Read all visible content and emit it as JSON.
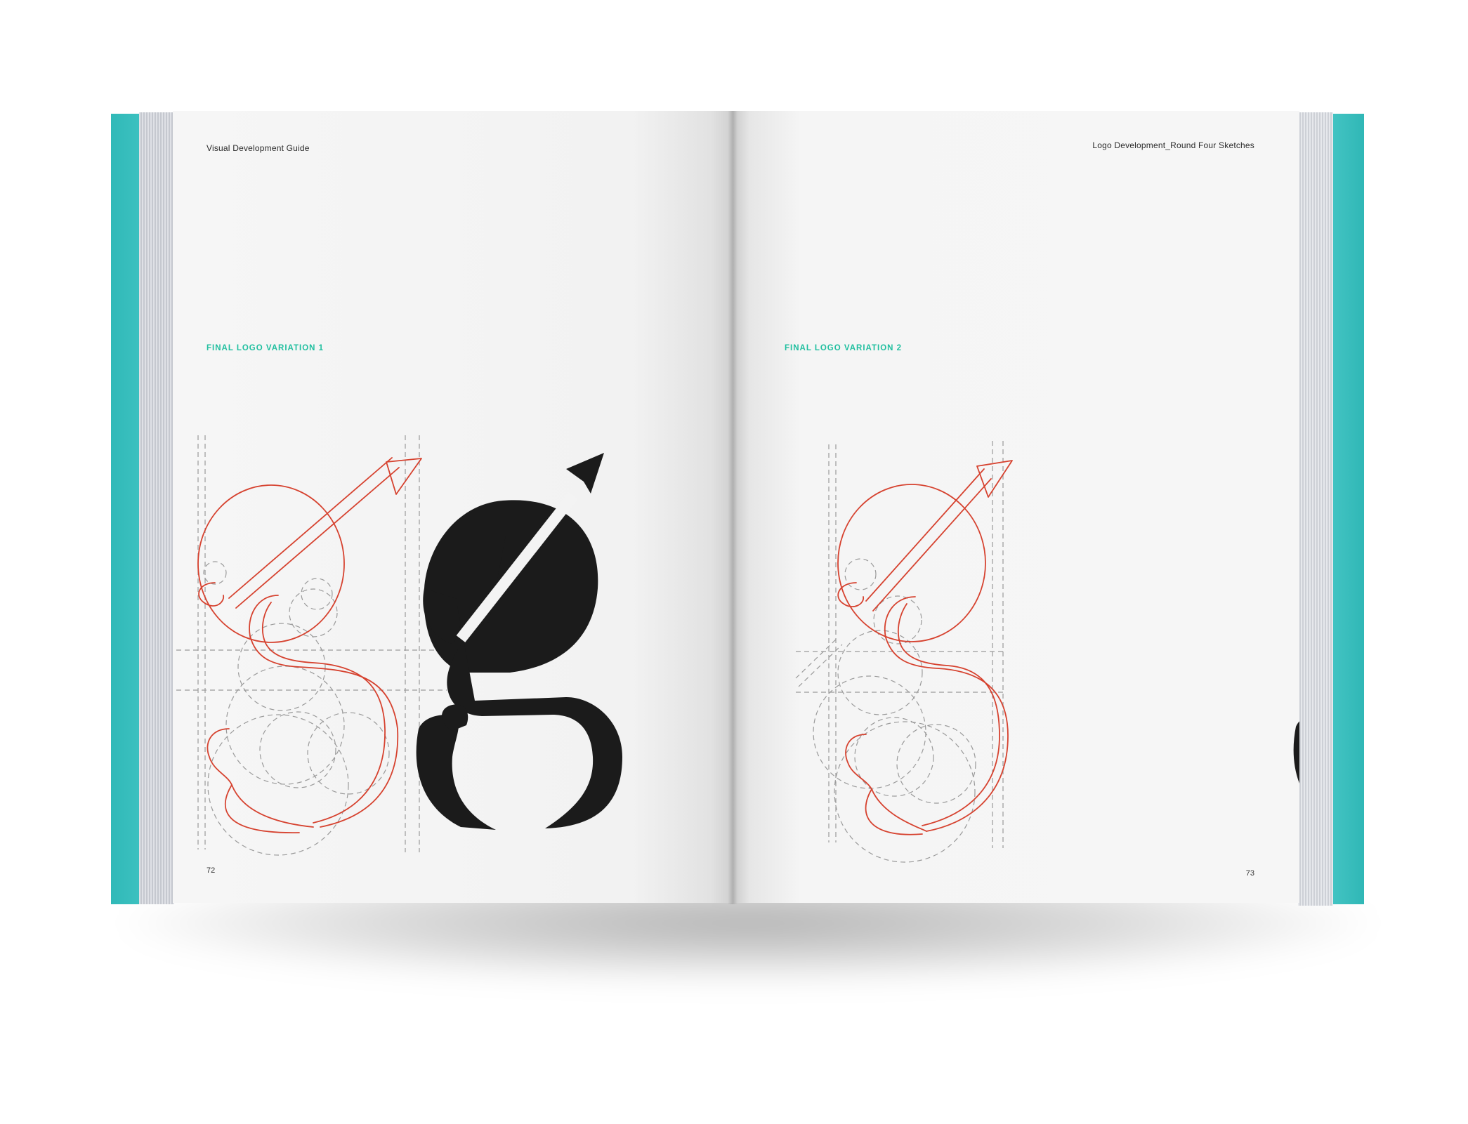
{
  "spread": {
    "left_page": {
      "running_head": "Visual Development Guide",
      "section_title": "FINAL LOGO VARIATION 1",
      "page_number": "72"
    },
    "right_page": {
      "running_head": "Logo Development_Round Four Sketches",
      "section_title": "FINAL LOGO VARIATION 2",
      "page_number": "73"
    }
  },
  "colors": {
    "accent_teal": "#1fbf9f",
    "cover_teal": "#3ec2c1",
    "sketch_red": "#d6422f",
    "guide_gray": "#9a9a9a",
    "logo_black": "#1b1b1b"
  },
  "icons": {
    "logo_mark": "g-letter-with-arrow-icon"
  }
}
